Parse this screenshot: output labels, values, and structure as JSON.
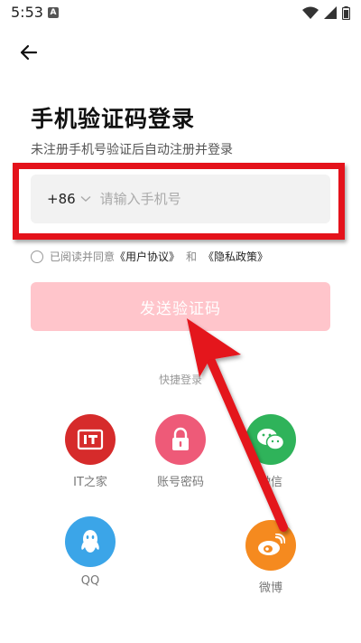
{
  "status_bar": {
    "time": "5:53",
    "notification_badge": "A"
  },
  "header": {
    "back_icon": "back-arrow-icon"
  },
  "title": "手机验证码登录",
  "subtitle": "未注册手机号验证后自动注册并登录",
  "phone": {
    "country_code": "+86",
    "placeholder": "请输入手机号",
    "value": ""
  },
  "agreement": {
    "checked": false,
    "prefix": "已阅读并同意",
    "user_agreement": "《用户协议》",
    "connector": "和",
    "privacy_policy": "《隐私政策》"
  },
  "send_button": {
    "label": "发送验证码"
  },
  "quick_login": {
    "title": "快捷登录",
    "items": [
      {
        "label": "IT之家",
        "icon": "ithome-logo-icon",
        "color": "#d62b2b"
      },
      {
        "label": "账号密码",
        "icon": "lock-icon",
        "color": "#ee5a78"
      },
      {
        "label": "微信",
        "icon": "wechat-icon",
        "color": "#2fb35a"
      },
      {
        "label": "QQ",
        "icon": "qq-icon",
        "color": "#3ba5e8"
      },
      {
        "label": "微博",
        "icon": "weibo-icon",
        "color": "#f58a1f"
      }
    ]
  },
  "colors": {
    "highlight_red": "#e4121b",
    "send_button_bg": "#ffc5cb",
    "field_bg": "#f2f2f2"
  }
}
